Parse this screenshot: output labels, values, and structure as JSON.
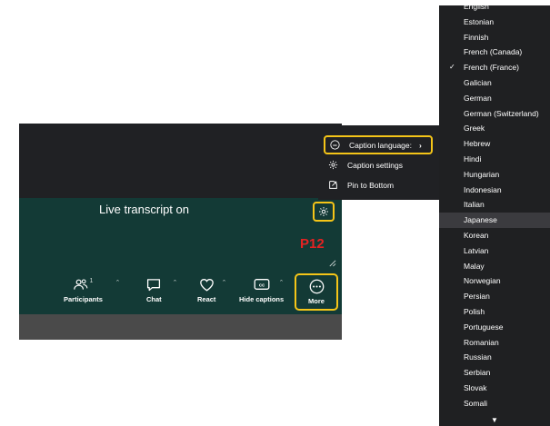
{
  "meeting": {
    "live_transcript": "Live transcript on",
    "annotation": "P12"
  },
  "toolbar": {
    "participants": {
      "label": "Participants",
      "count": "1"
    },
    "chat": {
      "label": "Chat"
    },
    "react": {
      "label": "React"
    },
    "captions": {
      "label": "Hide captions"
    },
    "more": {
      "label": "More"
    }
  },
  "menu": {
    "items": [
      {
        "label": "Caption language:",
        "icon": "cc-icon"
      },
      {
        "label": "Caption settings",
        "icon": "gear-icon"
      },
      {
        "label": "Pin to Bottom",
        "icon": "pin-icon"
      }
    ]
  },
  "languages": {
    "items": [
      "English",
      "Estonian",
      "Finnish",
      "French (Canada)",
      "French (France)",
      "Galician",
      "German",
      "German (Switzerland)",
      "Greek",
      "Hebrew",
      "Hindi",
      "Hungarian",
      "Indonesian",
      "Italian",
      "Japanese",
      "Korean",
      "Latvian",
      "Malay",
      "Norwegian",
      "Persian",
      "Polish",
      "Portuguese",
      "Romanian",
      "Russian",
      "Serbian",
      "Slovak",
      "Somali"
    ],
    "selected": "French (France)",
    "hovered": "Japanese"
  },
  "colors": {
    "highlight": "#f5c518",
    "teal": "#133a36",
    "dark": "#202124",
    "annotation": "#e52222"
  }
}
